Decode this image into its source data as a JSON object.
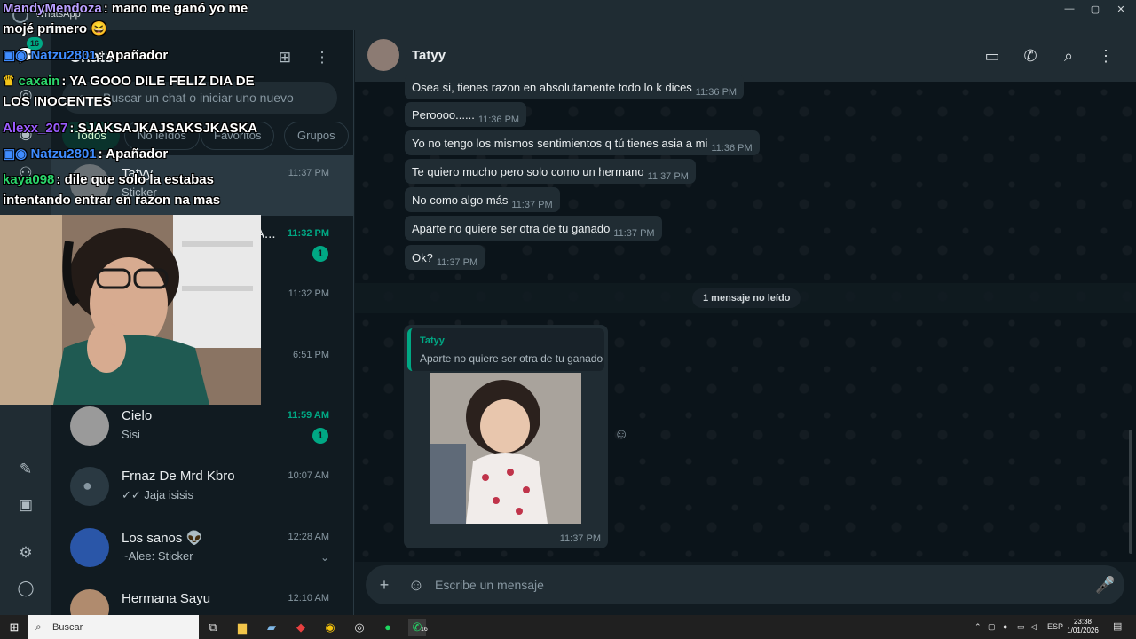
{
  "window": {
    "app_name": "WhatsApp",
    "controls": [
      "—",
      "▢",
      "✕"
    ]
  },
  "rail": {
    "chats_badge": "16"
  },
  "sidebar": {
    "title": "Chats",
    "search_placeholder": "Buscar un chat o iniciar uno nuevo",
    "filters": [
      "Todos",
      "No leídos",
      "Favoritos",
      "Grupos"
    ],
    "chats": [
      {
        "name": "Tatyy",
        "preview": "Sticker",
        "time": "11:37 PM",
        "unread": "",
        "selected": true
      },
      {
        "name": "A...",
        "preview": "",
        "time": "11:32 PM",
        "unread": "1"
      },
      {
        "name": "",
        "preview": "",
        "time": "11:32 PM",
        "unread": ""
      },
      {
        "name": "",
        "preview": "",
        "time": "6:51 PM",
        "unread": ""
      },
      {
        "name": "Cielo",
        "preview": "Sisi",
        "time": "11:59 AM",
        "unread": "1"
      },
      {
        "name": "Frnaz De Mrd Kbro",
        "preview": "✓✓ Jaja isisis",
        "time": "10:07 AM",
        "unread": ""
      },
      {
        "name": "Los sanos 👽",
        "preview": "~Alee: Sticker",
        "time": "12:28 AM",
        "unread": ""
      },
      {
        "name": "Hermana Sayu",
        "preview": "",
        "time": "12:10 AM",
        "unread": ""
      }
    ]
  },
  "conversation": {
    "contact_name": "Tatyy",
    "messages": [
      {
        "text": "Osea si, tienes razon en absolutamente todo lo k dices",
        "time": "11:36 PM"
      },
      {
        "text": "Peroooo......",
        "time": "11:36 PM"
      },
      {
        "text": "Yo no tengo los mismos sentimientos q tú tienes asia a mi",
        "time": "11:36 PM"
      },
      {
        "text": "Te quiero mucho pero solo como un hermano",
        "time": "11:37 PM"
      },
      {
        "text": "No como algo más",
        "time": "11:37 PM"
      },
      {
        "text": "Aparte no quiere ser otra de tu ganado",
        "time": "11:37 PM"
      },
      {
        "text": "Ok?",
        "time": "11:37 PM"
      }
    ],
    "unread_divider": "1 mensaje no leído",
    "reply": {
      "quoted_name": "Tatyy",
      "quoted_text": "Aparte no quiere ser otra de tu ganado",
      "time": "11:37 PM"
    },
    "composer_placeholder": "Escribe un mensaje"
  },
  "stream_chat": [
    {
      "user": "MandyMendoza",
      "color": "#b9a0ff",
      "text": ": mano me ganó yo me mojé primero 😆"
    },
    {
      "user": "Natzu2801",
      "color": "#3f8cff",
      "text": ": Apañador"
    },
    {
      "user": "caxain",
      "color": "#2bd66b",
      "text": ": YA GOOO DILE FELIZ DIA DE LOS INOCENTES"
    },
    {
      "user": "Alexx_207",
      "color": "#9b5cff",
      "text": ": SJAKSAJKAJSAKSJKASKA"
    },
    {
      "user": "Natzu2801",
      "color": "#3f8cff",
      "text": ": Apañador"
    },
    {
      "user": "kaya098",
      "color": "#2bd66b",
      "text": ": dile que solo la estabas intentando entrar en razon na mas"
    }
  ],
  "taskbar": {
    "search_label": "Buscar",
    "lang": "ESP",
    "time": "23:38",
    "date": "1/01/2026",
    "whatsapp_badge": "16"
  },
  "colors": {
    "accent": "#00a884",
    "panel_bg": "#111b21",
    "header_bg": "#202c33",
    "bubble_in": "#202c33"
  }
}
